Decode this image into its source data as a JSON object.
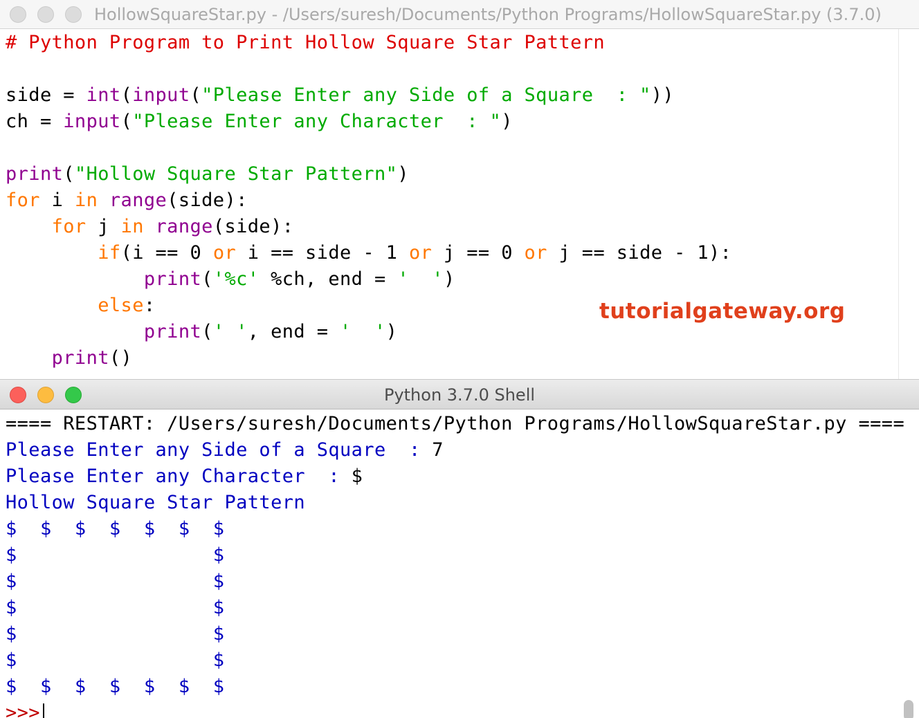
{
  "editor": {
    "title": "HollowSquareStar.py - /Users/suresh/Documents/Python Programs/HollowSquareStar.py (3.7.0)",
    "lines": [
      [
        {
          "t": "# Python Program to Print Hollow Square Star Pattern",
          "c": "com"
        }
      ],
      [],
      [
        {
          "t": "side = "
        },
        {
          "t": "int",
          "c": "bi"
        },
        {
          "t": "("
        },
        {
          "t": "input",
          "c": "bi"
        },
        {
          "t": "("
        },
        {
          "t": "\"Please Enter any Side of a Square  : \"",
          "c": "str"
        },
        {
          "t": "))"
        }
      ],
      [
        {
          "t": "ch = "
        },
        {
          "t": "input",
          "c": "bi"
        },
        {
          "t": "("
        },
        {
          "t": "\"Please Enter any Character  : \"",
          "c": "str"
        },
        {
          "t": ")"
        }
      ],
      [],
      [
        {
          "t": "print",
          "c": "bi"
        },
        {
          "t": "("
        },
        {
          "t": "\"Hollow Square Star Pattern\"",
          "c": "str"
        },
        {
          "t": ")"
        }
      ],
      [
        {
          "t": "for",
          "c": "kw"
        },
        {
          "t": " i "
        },
        {
          "t": "in",
          "c": "kw"
        },
        {
          "t": " "
        },
        {
          "t": "range",
          "c": "bi"
        },
        {
          "t": "(side):"
        }
      ],
      [
        {
          "t": "    "
        },
        {
          "t": "for",
          "c": "kw"
        },
        {
          "t": " j "
        },
        {
          "t": "in",
          "c": "kw"
        },
        {
          "t": " "
        },
        {
          "t": "range",
          "c": "bi"
        },
        {
          "t": "(side):"
        }
      ],
      [
        {
          "t": "        "
        },
        {
          "t": "if",
          "c": "kw"
        },
        {
          "t": "(i == 0 "
        },
        {
          "t": "or",
          "c": "kw"
        },
        {
          "t": " i == side - 1 "
        },
        {
          "t": "or",
          "c": "kw"
        },
        {
          "t": " j == 0 "
        },
        {
          "t": "or",
          "c": "kw"
        },
        {
          "t": " j == side - 1):"
        }
      ],
      [
        {
          "t": "            "
        },
        {
          "t": "print",
          "c": "bi"
        },
        {
          "t": "("
        },
        {
          "t": "'%c'",
          "c": "str"
        },
        {
          "t": " %ch, end = "
        },
        {
          "t": "'  '",
          "c": "str"
        },
        {
          "t": ")"
        }
      ],
      [
        {
          "t": "        "
        },
        {
          "t": "else",
          "c": "kw"
        },
        {
          "t": ":"
        }
      ],
      [
        {
          "t": "            "
        },
        {
          "t": "print",
          "c": "bi"
        },
        {
          "t": "("
        },
        {
          "t": "' '",
          "c": "str"
        },
        {
          "t": ", end = "
        },
        {
          "t": "'  '",
          "c": "str"
        },
        {
          "t": ")"
        }
      ],
      [
        {
          "t": "    "
        },
        {
          "t": "print",
          "c": "bi"
        },
        {
          "t": "()"
        }
      ]
    ]
  },
  "watermark": "tutorialgateway.org",
  "shell": {
    "title": "Python 3.7.0 Shell",
    "lines": [
      [
        {
          "t": "==== RESTART: /Users/suresh/Documents/Python Programs/HollowSquareStar.py ===="
        }
      ],
      [
        {
          "t": "Please Enter any Side of a Square  : ",
          "c": "out"
        },
        {
          "t": "7"
        }
      ],
      [
        {
          "t": "Please Enter any Character  : ",
          "c": "out"
        },
        {
          "t": "$"
        }
      ],
      [
        {
          "t": "Hollow Square Star Pattern",
          "c": "out"
        }
      ],
      [
        {
          "t": "$  $  $  $  $  $  $",
          "c": "out"
        }
      ],
      [
        {
          "t": "$                 $",
          "c": "out"
        }
      ],
      [
        {
          "t": "$                 $",
          "c": "out"
        }
      ],
      [
        {
          "t": "$                 $",
          "c": "out"
        }
      ],
      [
        {
          "t": "$                 $",
          "c": "out"
        }
      ],
      [
        {
          "t": "$                 $",
          "c": "out"
        }
      ],
      [
        {
          "t": "$  $  $  $  $  $  $",
          "c": "out"
        }
      ]
    ],
    "prompt": ">>>"
  },
  "colors": {
    "comment": "#dd0000",
    "builtin": "#900090",
    "string": "#00aa00",
    "keyword": "#ff7700",
    "output": "#0000c0",
    "watermark": "#e0401c"
  }
}
